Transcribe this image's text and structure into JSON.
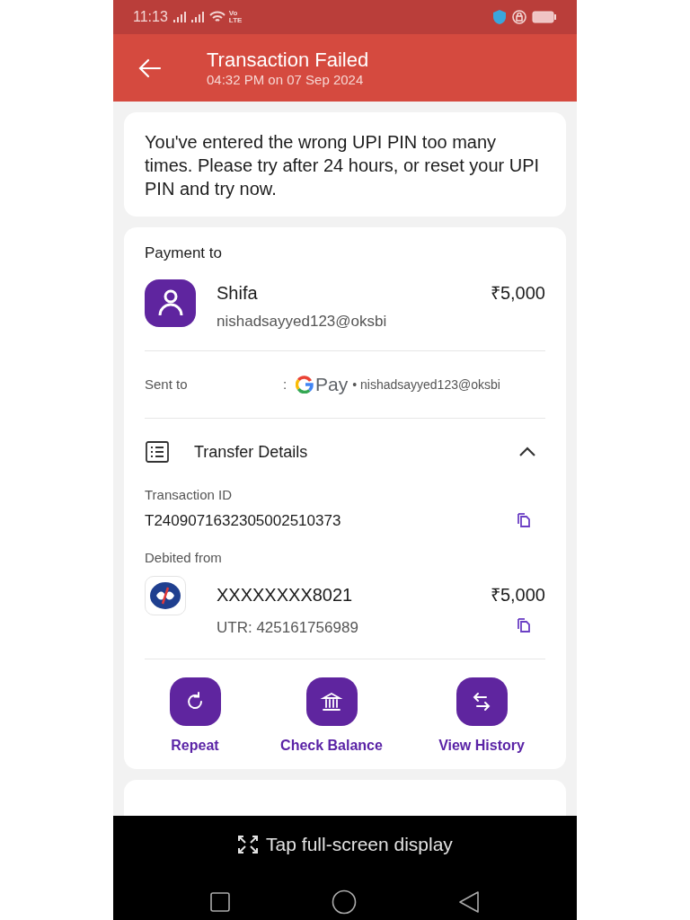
{
  "status_bar": {
    "time": "11:13",
    "network_label": "Vo LTE"
  },
  "header": {
    "title": "Transaction Failed",
    "subtitle": "04:32 PM on 07 Sep 2024"
  },
  "message": "You've entered the wrong UPI PIN too many times. Please try after 24 hours, or reset your UPI PIN and try now.",
  "payment": {
    "heading": "Payment to",
    "name": "Shifa",
    "upi_id": "nishadsayyed123@oksbi",
    "amount": "₹5,000",
    "sent_to_label": "Sent to",
    "separator": ":",
    "app_label": "Pay",
    "sent_to_id": "• nishadsayyed123@oksbi"
  },
  "transfer_details": {
    "title": "Transfer Details",
    "expanded": true,
    "transaction_id_label": "Transaction ID",
    "transaction_id": "T2409071632305002510373",
    "debited_from_label": "Debited from",
    "account": "XXXXXXXX8021",
    "amount": "₹5,000",
    "utr": "UTR: 425161756989"
  },
  "actions": [
    {
      "kind": "repeat",
      "label": "Repeat"
    },
    {
      "kind": "balance",
      "label": "Check Balance"
    },
    {
      "kind": "history",
      "label": "View History"
    }
  ],
  "overlay": {
    "label": "Tap full-screen display"
  }
}
